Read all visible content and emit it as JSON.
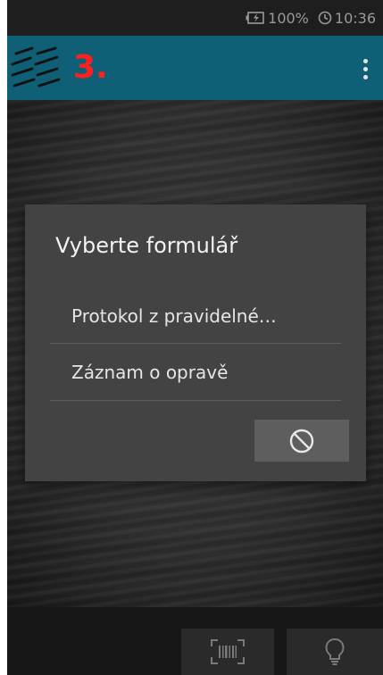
{
  "status_bar": {
    "battery_percent": "100%",
    "time": "10:36",
    "icons": [
      "battery-charging-icon",
      "clock-icon"
    ]
  },
  "app_bar": {
    "step_label": "3.",
    "logo_icon": "striped-logo-icon",
    "menu_icon": "overflow-menu-icon"
  },
  "dialog": {
    "title": "Vyberte formulář",
    "items": [
      {
        "label": "Protokol z pravidelné…"
      },
      {
        "label": "Záznam o opravě"
      }
    ],
    "cancel_icon": "prohibited-icon"
  },
  "bottom_bar": {
    "buttons": [
      {
        "icon": "barcode-scan-icon"
      },
      {
        "icon": "lightbulb-icon"
      }
    ]
  },
  "colors": {
    "app_bar": "#0f5f76",
    "step_label": "#ff1f1f",
    "dialog_bg": "#434343",
    "cancel_button": "#5e5e5e"
  }
}
